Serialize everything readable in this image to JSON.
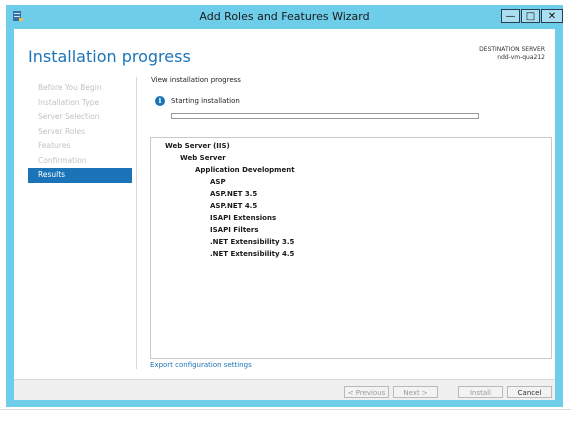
{
  "window": {
    "title": "Add Roles and Features Wizard",
    "controls": {
      "minimize": "—",
      "maximize": "□",
      "close": "✕"
    }
  },
  "header": {
    "page_title": "Installation progress",
    "destination_label": "DESTINATION SERVER",
    "destination_server": "ndd-vm-qua212"
  },
  "steps": [
    {
      "label": "Before You Begin",
      "active": false
    },
    {
      "label": "Installation Type",
      "active": false
    },
    {
      "label": "Server Selection",
      "active": false
    },
    {
      "label": "Server Roles",
      "active": false
    },
    {
      "label": "Features",
      "active": false
    },
    {
      "label": "Confirmation",
      "active": false
    },
    {
      "label": "Results",
      "active": true
    }
  ],
  "main": {
    "subtitle": "View installation progress",
    "status_text": "Starting installation",
    "progress_fraction": 0.0,
    "features": [
      {
        "label": "Web Server (IIS)",
        "level": 0
      },
      {
        "label": "Web Server",
        "level": 1
      },
      {
        "label": "Application Development",
        "level": 2
      },
      {
        "label": "ASP",
        "level": 3
      },
      {
        "label": "ASP.NET 3.5",
        "level": 3
      },
      {
        "label": "ASP.NET 4.5",
        "level": 3
      },
      {
        "label": "ISAPI Extensions",
        "level": 3
      },
      {
        "label": "ISAPI Filters",
        "level": 3
      },
      {
        "label": ".NET Extensibility 3.5",
        "level": 3
      },
      {
        "label": ".NET Extensibility 4.5",
        "level": 3
      }
    ],
    "export_link": "Export configuration settings"
  },
  "footer": {
    "previous": "< Previous",
    "next": "Next >",
    "install": "Install",
    "cancel": "Cancel"
  },
  "colors": {
    "accent": "#1b74b8",
    "titlebar": "#6ecde8"
  }
}
